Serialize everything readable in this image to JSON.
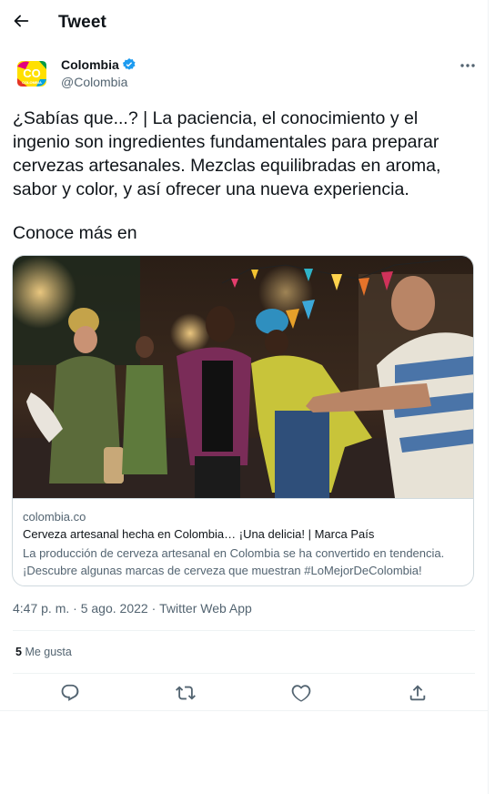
{
  "header": {
    "title": "Tweet",
    "back_icon": "arrow-left-icon"
  },
  "author": {
    "name": "Colombia",
    "handle": "@Colombia",
    "avatar_text": "CO",
    "avatar_subtext": "COLOMBIA",
    "verified_color": "#1d9bf0"
  },
  "tweet": {
    "text": "¿Sabías que...? |  La paciencia, el conocimiento y el ingenio son ingredientes fundamentales para preparar cervezas artesanales. Mezclas equilibradas en aroma, sabor y color, y así ofrecer una nueva experiencia.",
    "text2": "Conoce más en"
  },
  "card": {
    "domain": "colombia.co",
    "title": "Cerveza artesanal hecha en Colombia… ¡Una delicia! | Marca País",
    "description": "La producción de cerveza artesanal en Colombia se ha convertido en tendencia. ¡Descubre algunas marcas de cerveza que muestran #LoMejorDeColombia!"
  },
  "meta": {
    "time": "4:47 p. m.",
    "sep": " · ",
    "date": "5 ago. 2022",
    "source": "Twitter Web App"
  },
  "stats": {
    "likes_count": "5",
    "likes_label": "Me gusta"
  },
  "actions": [
    "reply-icon",
    "retweet-icon",
    "like-icon",
    "share-icon"
  ],
  "colors": {
    "text": "#0f1419",
    "secondary": "#536471",
    "border": "#cfd9de",
    "accent": "#1d9bf0"
  }
}
